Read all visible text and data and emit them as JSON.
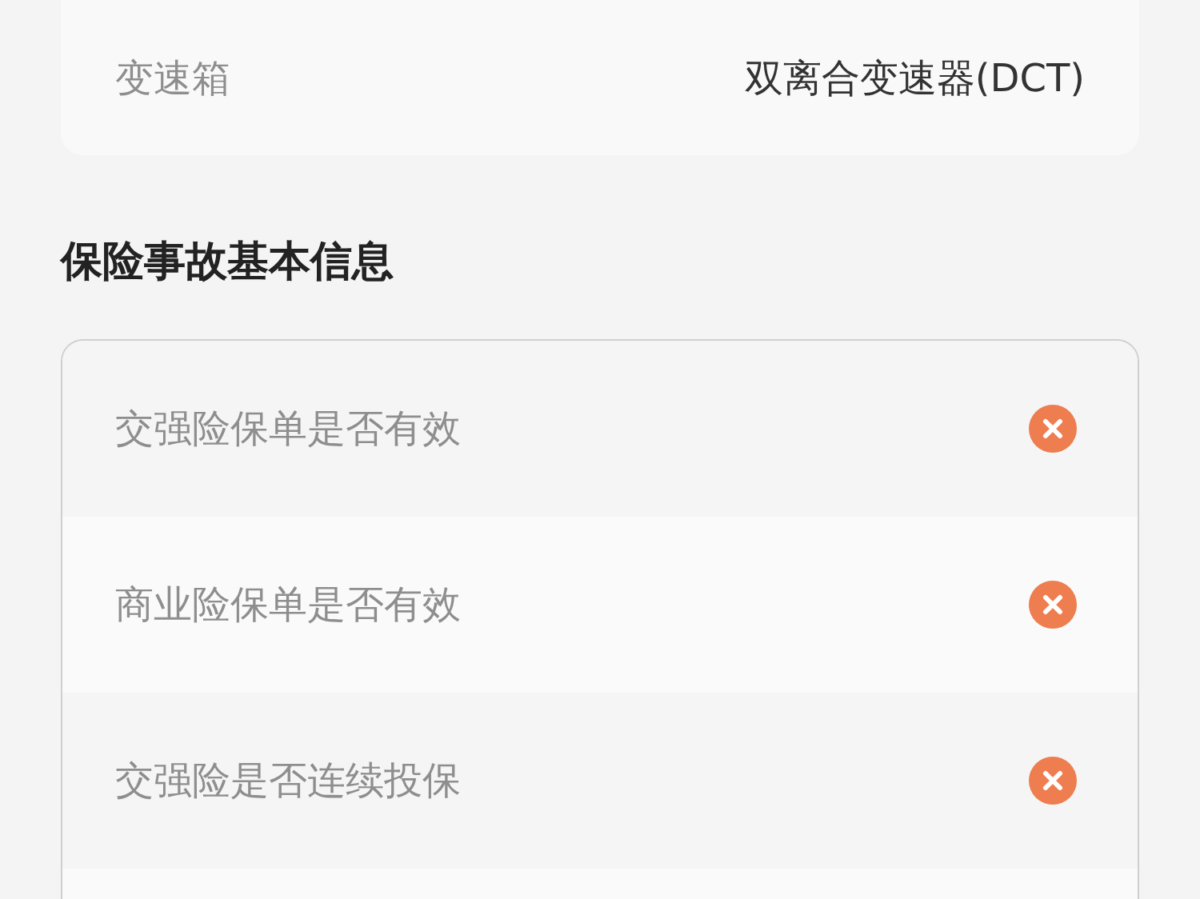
{
  "vehicle_card": {
    "rows": [
      {
        "label": "变速箱",
        "value": "双离合变速器(DCT)"
      }
    ]
  },
  "section": {
    "title": "保险事故基本信息",
    "items": [
      {
        "label": "交强险保单是否有效",
        "valid": false
      },
      {
        "label": "商业险保单是否有效",
        "valid": false
      },
      {
        "label": "交强险是否连续投保",
        "valid": false
      }
    ]
  }
}
